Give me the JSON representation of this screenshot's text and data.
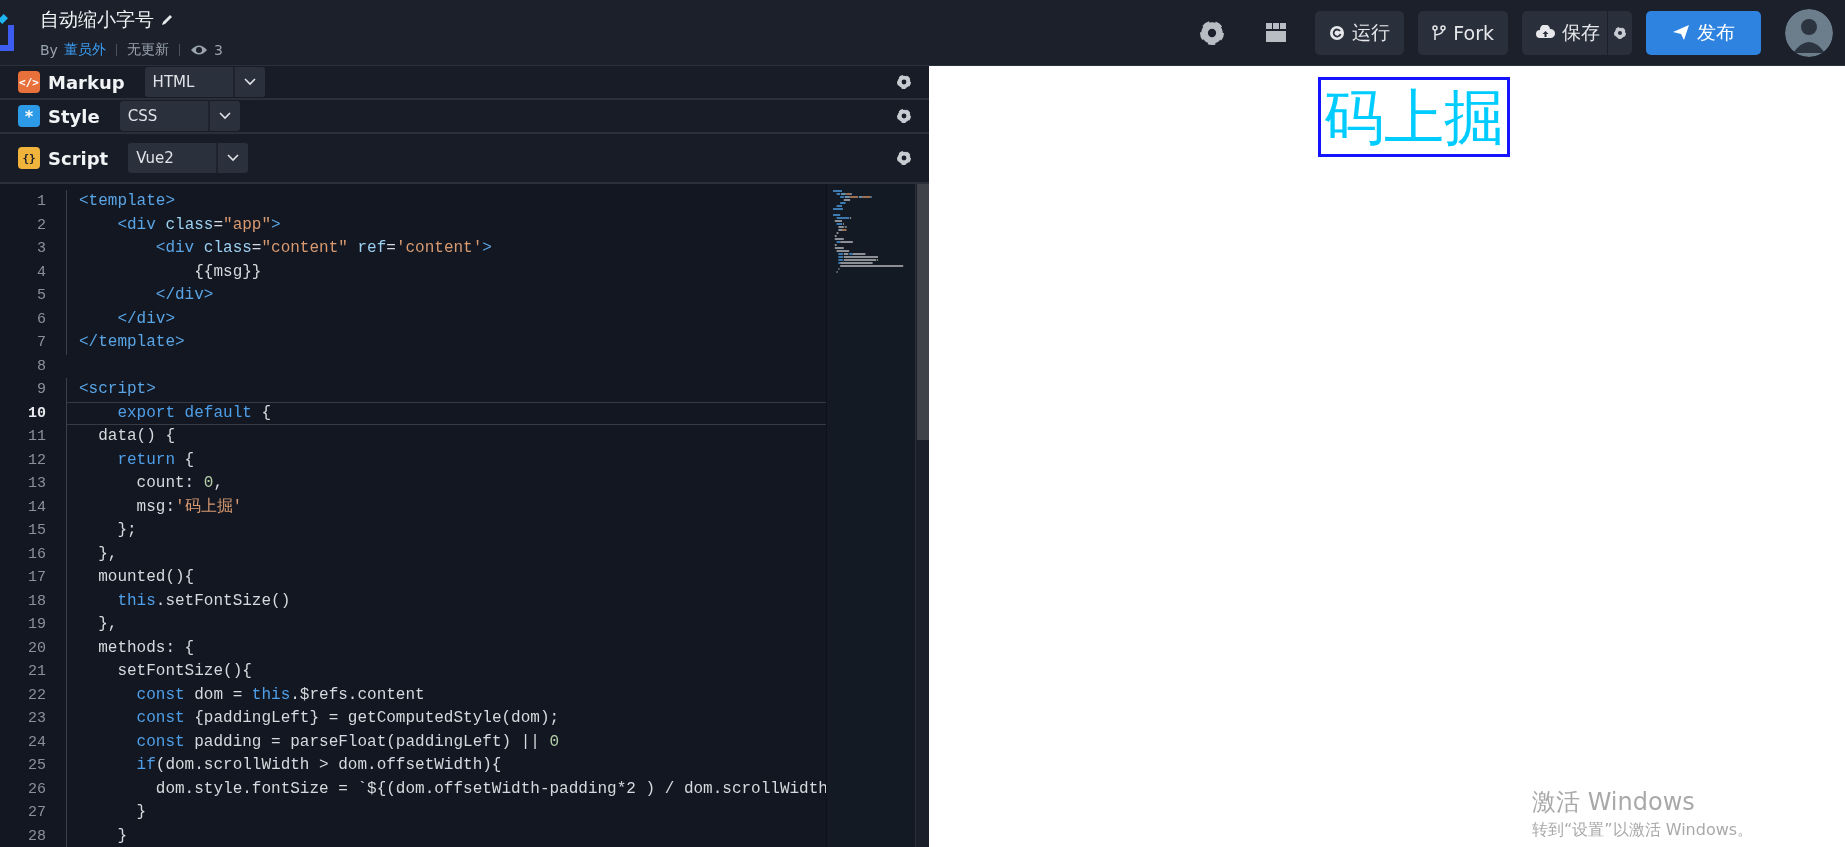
{
  "header": {
    "title": "自动缩小字号",
    "author_prefix": "By",
    "author": "董员外",
    "update_status": "无更新",
    "views": "3",
    "buttons": [
      {
        "kind": "run",
        "label": "运行"
      },
      {
        "kind": "fork",
        "label": "Fork"
      },
      {
        "kind": "save",
        "label": "保存"
      },
      {
        "kind": "publish",
        "label": "发布"
      }
    ]
  },
  "panels": [
    {
      "kind": "markup",
      "badge": "</>",
      "label": "Markup",
      "language": "HTML"
    },
    {
      "kind": "style",
      "badge": "*",
      "label": "Style",
      "language": "CSS"
    },
    {
      "kind": "script",
      "badge": "{}",
      "label": "Script",
      "language": "Vue2"
    }
  ],
  "editor": {
    "lines": [
      {
        "number": "1",
        "current": false,
        "tokens": [
          {
            "kind": "tag",
            "text": "<template>"
          }
        ]
      },
      {
        "number": "2",
        "current": false,
        "tokens": [
          {
            "kind": "tag",
            "text": "    <div "
          },
          {
            "kind": "attr",
            "text": "class"
          },
          {
            "kind": "plain",
            "text": "="
          },
          {
            "kind": "str",
            "text": "\"app\""
          },
          {
            "kind": "tag",
            "text": ">"
          }
        ]
      },
      {
        "number": "3",
        "current": false,
        "tokens": [
          {
            "kind": "tag",
            "text": "        <div "
          },
          {
            "kind": "attr",
            "text": "class"
          },
          {
            "kind": "plain",
            "text": "="
          },
          {
            "kind": "str",
            "text": "\"content\" "
          },
          {
            "kind": "attr",
            "text": "ref"
          },
          {
            "kind": "plain",
            "text": "="
          },
          {
            "kind": "str",
            "text": "'content'"
          },
          {
            "kind": "tag",
            "text": ">"
          }
        ]
      },
      {
        "number": "4",
        "current": false,
        "tokens": [
          {
            "kind": "plain",
            "text": "            {{msg}}"
          }
        ]
      },
      {
        "number": "5",
        "current": false,
        "tokens": [
          {
            "kind": "tag",
            "text": "        </div>"
          }
        ]
      },
      {
        "number": "6",
        "current": false,
        "tokens": [
          {
            "kind": "tag",
            "text": "    </div>"
          }
        ]
      },
      {
        "number": "7",
        "current": false,
        "tokens": [
          {
            "kind": "tag",
            "text": "</template>"
          }
        ]
      },
      {
        "number": "8",
        "current": false
      },
      {
        "number": "9",
        "current": false,
        "tokens": [
          {
            "kind": "tag",
            "text": "<script>"
          }
        ]
      },
      {
        "number": "10",
        "current": true,
        "tokens": [
          {
            "kind": "kw",
            "text": "    export default"
          },
          {
            "kind": "plain",
            "text": " {"
          }
        ]
      },
      {
        "number": "11",
        "current": false,
        "tokens": [
          {
            "kind": "plain",
            "text": "  data() {"
          }
        ]
      },
      {
        "number": "12",
        "current": false,
        "tokens": [
          {
            "kind": "kw",
            "text": "    return"
          },
          {
            "kind": "plain",
            "text": " {"
          }
        ]
      },
      {
        "number": "13",
        "current": false,
        "tokens": [
          {
            "kind": "plain",
            "text": "      count: "
          },
          {
            "kind": "num",
            "text": "0"
          },
          {
            "kind": "plain",
            "text": ","
          }
        ]
      },
      {
        "number": "14",
        "current": false,
        "tokens": [
          {
            "kind": "plain",
            "text": "      msg:"
          },
          {
            "kind": "str",
            "text": "'码上掘'"
          }
        ]
      },
      {
        "number": "15",
        "current": false,
        "tokens": [
          {
            "kind": "plain",
            "text": "    };"
          }
        ]
      },
      {
        "number": "16",
        "current": false,
        "tokens": [
          {
            "kind": "plain",
            "text": "  },"
          }
        ]
      },
      {
        "number": "17",
        "current": false,
        "tokens": [
          {
            "kind": "plain",
            "text": "  mounted(){"
          }
        ]
      },
      {
        "number": "18",
        "current": false,
        "tokens": [
          {
            "kind": "kw",
            "text": "    this"
          },
          {
            "kind": "plain",
            "text": ".setFontSize()"
          }
        ]
      },
      {
        "number": "19",
        "current": false,
        "tokens": [
          {
            "kind": "plain",
            "text": "  },"
          }
        ]
      },
      {
        "number": "20",
        "current": false,
        "tokens": [
          {
            "kind": "plain",
            "text": "  methods: {"
          }
        ]
      },
      {
        "number": "21",
        "current": false,
        "tokens": [
          {
            "kind": "plain",
            "text": "    setFontSize(){"
          }
        ]
      },
      {
        "number": "22",
        "current": false,
        "tokens": [
          {
            "kind": "kw",
            "text": "      const"
          },
          {
            "kind": "plain",
            "text": " dom = "
          },
          {
            "kind": "kw",
            "text": "this"
          },
          {
            "kind": "plain",
            "text": ".$refs.content"
          }
        ]
      },
      {
        "number": "23",
        "current": false,
        "tokens": [
          {
            "kind": "kw",
            "text": "      const"
          },
          {
            "kind": "plain",
            "text": " {paddingLeft} = getComputedStyle(dom);"
          }
        ]
      },
      {
        "number": "24",
        "current": false,
        "tokens": [
          {
            "kind": "kw",
            "text": "      const"
          },
          {
            "kind": "plain",
            "text": " padding = parseFloat(paddingLeft) || "
          },
          {
            "kind": "num",
            "text": "0"
          }
        ]
      },
      {
        "number": "25",
        "current": false,
        "tokens": [
          {
            "kind": "kw",
            "text": "      if"
          },
          {
            "kind": "plain",
            "text": "(dom.scrollWidth > dom.offsetWidth){"
          }
        ]
      },
      {
        "number": "26",
        "current": false,
        "tokens": [
          {
            "kind": "plain",
            "text": "        dom.style.fontSize = `${(dom.offsetWidth-padding*2 ) / dom.scrollWidth"
          }
        ]
      },
      {
        "number": "27",
        "current": false,
        "tokens": [
          {
            "kind": "plain",
            "text": "      }"
          }
        ]
      },
      {
        "number": "28",
        "current": false,
        "tokens": [
          {
            "kind": "plain",
            "text": "    }"
          }
        ]
      }
    ]
  },
  "preview": {
    "text": "码上掘"
  },
  "os_notice": {
    "title": "激活 Windows",
    "message": "转到“设置”以激活 Windows。"
  }
}
